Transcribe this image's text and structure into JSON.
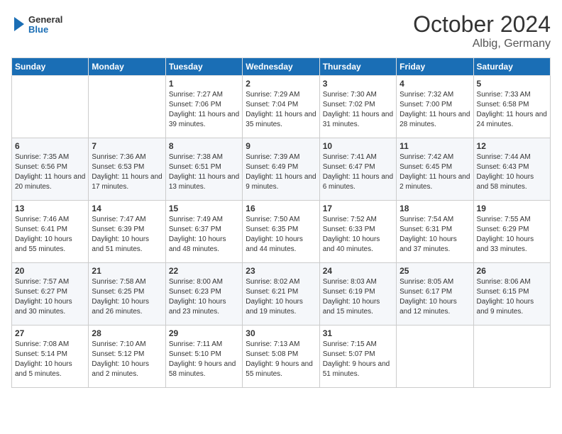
{
  "header": {
    "logo_line1": "General",
    "logo_line2": "Blue",
    "month": "October 2024",
    "location": "Albig, Germany"
  },
  "days_of_week": [
    "Sunday",
    "Monday",
    "Tuesday",
    "Wednesday",
    "Thursday",
    "Friday",
    "Saturday"
  ],
  "weeks": [
    [
      {
        "num": "",
        "info": ""
      },
      {
        "num": "",
        "info": ""
      },
      {
        "num": "1",
        "info": "Sunrise: 7:27 AM\nSunset: 7:06 PM\nDaylight: 11 hours and 39 minutes."
      },
      {
        "num": "2",
        "info": "Sunrise: 7:29 AM\nSunset: 7:04 PM\nDaylight: 11 hours and 35 minutes."
      },
      {
        "num": "3",
        "info": "Sunrise: 7:30 AM\nSunset: 7:02 PM\nDaylight: 11 hours and 31 minutes."
      },
      {
        "num": "4",
        "info": "Sunrise: 7:32 AM\nSunset: 7:00 PM\nDaylight: 11 hours and 28 minutes."
      },
      {
        "num": "5",
        "info": "Sunrise: 7:33 AM\nSunset: 6:58 PM\nDaylight: 11 hours and 24 minutes."
      }
    ],
    [
      {
        "num": "6",
        "info": "Sunrise: 7:35 AM\nSunset: 6:56 PM\nDaylight: 11 hours and 20 minutes."
      },
      {
        "num": "7",
        "info": "Sunrise: 7:36 AM\nSunset: 6:53 PM\nDaylight: 11 hours and 17 minutes."
      },
      {
        "num": "8",
        "info": "Sunrise: 7:38 AM\nSunset: 6:51 PM\nDaylight: 11 hours and 13 minutes."
      },
      {
        "num": "9",
        "info": "Sunrise: 7:39 AM\nSunset: 6:49 PM\nDaylight: 11 hours and 9 minutes."
      },
      {
        "num": "10",
        "info": "Sunrise: 7:41 AM\nSunset: 6:47 PM\nDaylight: 11 hours and 6 minutes."
      },
      {
        "num": "11",
        "info": "Sunrise: 7:42 AM\nSunset: 6:45 PM\nDaylight: 11 hours and 2 minutes."
      },
      {
        "num": "12",
        "info": "Sunrise: 7:44 AM\nSunset: 6:43 PM\nDaylight: 10 hours and 58 minutes."
      }
    ],
    [
      {
        "num": "13",
        "info": "Sunrise: 7:46 AM\nSunset: 6:41 PM\nDaylight: 10 hours and 55 minutes."
      },
      {
        "num": "14",
        "info": "Sunrise: 7:47 AM\nSunset: 6:39 PM\nDaylight: 10 hours and 51 minutes."
      },
      {
        "num": "15",
        "info": "Sunrise: 7:49 AM\nSunset: 6:37 PM\nDaylight: 10 hours and 48 minutes."
      },
      {
        "num": "16",
        "info": "Sunrise: 7:50 AM\nSunset: 6:35 PM\nDaylight: 10 hours and 44 minutes."
      },
      {
        "num": "17",
        "info": "Sunrise: 7:52 AM\nSunset: 6:33 PM\nDaylight: 10 hours and 40 minutes."
      },
      {
        "num": "18",
        "info": "Sunrise: 7:54 AM\nSunset: 6:31 PM\nDaylight: 10 hours and 37 minutes."
      },
      {
        "num": "19",
        "info": "Sunrise: 7:55 AM\nSunset: 6:29 PM\nDaylight: 10 hours and 33 minutes."
      }
    ],
    [
      {
        "num": "20",
        "info": "Sunrise: 7:57 AM\nSunset: 6:27 PM\nDaylight: 10 hours and 30 minutes."
      },
      {
        "num": "21",
        "info": "Sunrise: 7:58 AM\nSunset: 6:25 PM\nDaylight: 10 hours and 26 minutes."
      },
      {
        "num": "22",
        "info": "Sunrise: 8:00 AM\nSunset: 6:23 PM\nDaylight: 10 hours and 23 minutes."
      },
      {
        "num": "23",
        "info": "Sunrise: 8:02 AM\nSunset: 6:21 PM\nDaylight: 10 hours and 19 minutes."
      },
      {
        "num": "24",
        "info": "Sunrise: 8:03 AM\nSunset: 6:19 PM\nDaylight: 10 hours and 15 minutes."
      },
      {
        "num": "25",
        "info": "Sunrise: 8:05 AM\nSunset: 6:17 PM\nDaylight: 10 hours and 12 minutes."
      },
      {
        "num": "26",
        "info": "Sunrise: 8:06 AM\nSunset: 6:15 PM\nDaylight: 10 hours and 9 minutes."
      }
    ],
    [
      {
        "num": "27",
        "info": "Sunrise: 7:08 AM\nSunset: 5:14 PM\nDaylight: 10 hours and 5 minutes."
      },
      {
        "num": "28",
        "info": "Sunrise: 7:10 AM\nSunset: 5:12 PM\nDaylight: 10 hours and 2 minutes."
      },
      {
        "num": "29",
        "info": "Sunrise: 7:11 AM\nSunset: 5:10 PM\nDaylight: 9 hours and 58 minutes."
      },
      {
        "num": "30",
        "info": "Sunrise: 7:13 AM\nSunset: 5:08 PM\nDaylight: 9 hours and 55 minutes."
      },
      {
        "num": "31",
        "info": "Sunrise: 7:15 AM\nSunset: 5:07 PM\nDaylight: 9 hours and 51 minutes."
      },
      {
        "num": "",
        "info": ""
      },
      {
        "num": "",
        "info": ""
      }
    ]
  ]
}
